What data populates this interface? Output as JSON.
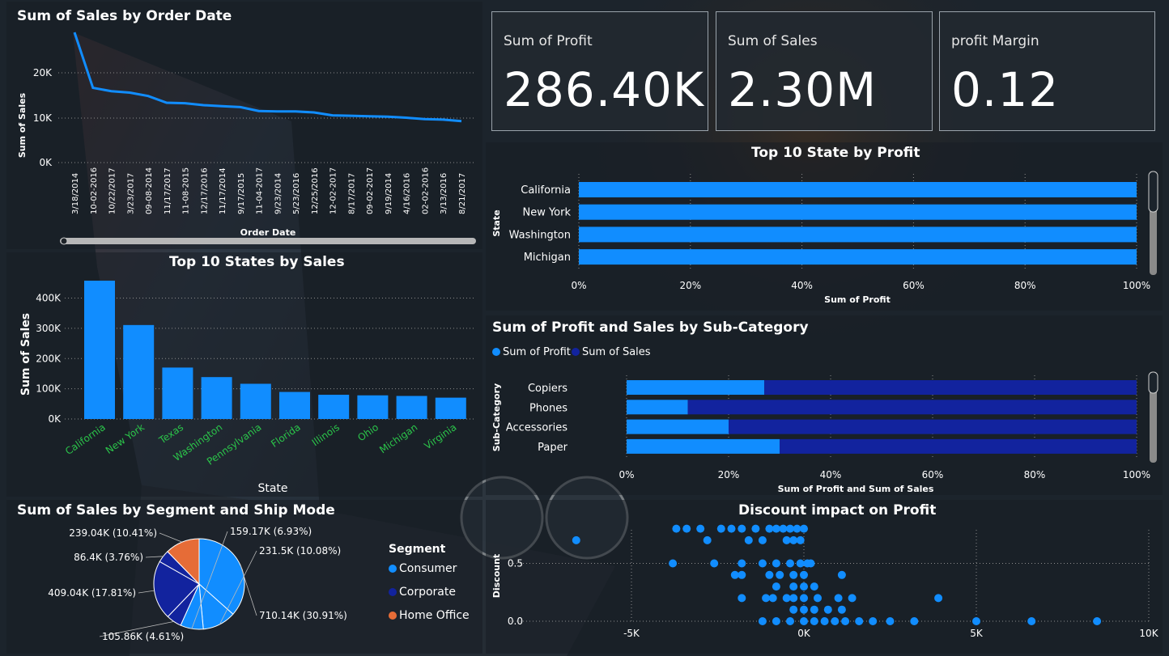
{
  "colors": {
    "primary": "#118dff",
    "secondary": "#12239e",
    "tertiary": "#e66c37",
    "green_label": "#2bc44a"
  },
  "kpis": [
    {
      "label": "Sum of Profit",
      "value": "286.40K"
    },
    {
      "label": "Sum of Sales",
      "value": "2.30M"
    },
    {
      "label": "profit Margin",
      "value": "0.12"
    }
  ],
  "line_chart": {
    "title": "Sum of Sales by Order Date",
    "ylabel": "Sum of Sales",
    "xlabel": "Order Date",
    "yticks": [
      "20K",
      "10K",
      "0K"
    ]
  },
  "states_sales": {
    "title": "Top 10 States by Sales",
    "ylabel": "Sum of Sales",
    "xlabel": "State",
    "yticks": [
      "400K",
      "300K",
      "200K",
      "100K",
      "0K"
    ]
  },
  "states_profit": {
    "title": "Top 10 State by Profit",
    "ylabel": "State",
    "xlabel": "Sum of Profit",
    "xticks": [
      "0%",
      "20%",
      "40%",
      "60%",
      "80%",
      "100%"
    ]
  },
  "subcat": {
    "title": "Sum of Profit and Sales by Sub-Category",
    "ylabel": "Sub-Category",
    "xlabel": "Sum of Profit and Sum of Sales",
    "xticks": [
      "0%",
      "20%",
      "40%",
      "60%",
      "80%",
      "100%"
    ],
    "legend": [
      "Sum of Profit",
      "Sum of Sales"
    ]
  },
  "pie": {
    "title": "Sum of Sales by Segment and Ship Mode",
    "legend_title": "Segment",
    "legend": [
      "Consumer",
      "Corporate",
      "Home Office"
    ]
  },
  "scatter": {
    "title": "Discount impact on Profit",
    "ylabel": "Discount",
    "xticks": [
      "-5K",
      "0K",
      "5K",
      "10K"
    ],
    "yticks": [
      "0.5",
      "0.0"
    ]
  },
  "chart_data": [
    {
      "type": "line",
      "title": "Sum of Sales by Order Date",
      "xlabel": "Order Date",
      "ylabel": "Sum of Sales",
      "ylim": [
        0,
        28000
      ],
      "x": [
        "3/18/2014",
        "10-02-2016",
        "10/22/2017",
        "3/23/2017",
        "09-08-2014",
        "11/17/2017",
        "11-08-2015",
        "12/17/2016",
        "11/17/2014",
        "9/17/2015",
        "11-04-2017",
        "9/23/2014",
        "5/23/2016",
        "12/25/2016",
        "12-02-2017",
        "8/17/2017",
        "09-02-2017",
        "9/19/2014",
        "4/16/2016",
        "02-02-2016",
        "3/13/2016",
        "8/21/2017"
      ],
      "values": [
        27000,
        15500,
        14800,
        14500,
        13800,
        12400,
        12300,
        11900,
        11700,
        11500,
        10700,
        10600,
        10600,
        10400,
        9800,
        9700,
        9600,
        9500,
        9300,
        9000,
        8900,
        8600
      ]
    },
    {
      "type": "bar",
      "title": "Top 10 States by Sales",
      "xlabel": "State",
      "ylabel": "Sum of Sales",
      "ylim": [
        0,
        450000
      ],
      "categories": [
        "California",
        "New York",
        "Texas",
        "Washington",
        "Pennsylvania",
        "Florida",
        "Illinois",
        "Ohio",
        "Michigan",
        "Virginia"
      ],
      "values": [
        457688,
        310876,
        170188,
        138641,
        116512,
        89474,
        80166,
        78258,
        76270,
        70637
      ]
    },
    {
      "type": "bar",
      "title": "Top 10 State by Profit",
      "orientation": "horizontal",
      "xlabel": "Sum of Profit",
      "ylabel": "State",
      "categories": [
        "California",
        "New York",
        "Washington",
        "Michigan"
      ],
      "values": [
        100,
        100,
        100,
        100
      ]
    },
    {
      "type": "bar",
      "title": "Sum of Profit and Sales by Sub-Category",
      "orientation": "horizontal",
      "stacked": "100%",
      "xlabel": "Sum of Profit and Sum of Sales",
      "ylabel": "Sub-Category",
      "categories": [
        "Copiers",
        "Phones",
        "Accessories",
        "Paper"
      ],
      "series": [
        {
          "name": "Sum of Profit",
          "values": [
            27,
            12,
            20,
            30
          ]
        },
        {
          "name": "Sum of Sales",
          "values": [
            73,
            88,
            80,
            70
          ]
        }
      ]
    },
    {
      "type": "pie",
      "title": "Sum of Sales by Segment and Ship Mode",
      "categories": [
        "Consumer",
        "Corporate",
        "Home Office"
      ],
      "labels": [
        "710.14K (30.91%)",
        "105.86K (4.61%)",
        "409.04K (17.81%)",
        "86.4K (3.76%)",
        "239.04K (10.41%)",
        "159.17K (6.93%)",
        "231.5K (10.08%)"
      ],
      "values": [
        710.14,
        231.5,
        159.17,
        105.86,
        409.04,
        86.4,
        239.04
      ],
      "series": [
        "Consumer",
        "Consumer",
        "Consumer",
        "Corporate",
        "Corporate",
        "Corporate",
        "Home Office"
      ]
    },
    {
      "type": "scatter",
      "title": "Discount impact on Profit",
      "ylabel": "Discount",
      "xlim": [
        -10000,
        10000
      ],
      "ylim": [
        0,
        0.85
      ],
      "points": [
        [
          -6600,
          0.7
        ],
        [
          -3700,
          0.8
        ],
        [
          -3400,
          0.8
        ],
        [
          -3000,
          0.8
        ],
        [
          -2800,
          0.7
        ],
        [
          -2400,
          0.8
        ],
        [
          -2100,
          0.8
        ],
        [
          -1800,
          0.8
        ],
        [
          -1600,
          0.7
        ],
        [
          -1400,
          0.8
        ],
        [
          -1200,
          0.7
        ],
        [
          -1000,
          0.8
        ],
        [
          -800,
          0.8
        ],
        [
          -600,
          0.8
        ],
        [
          -400,
          0.8
        ],
        [
          -200,
          0.8
        ],
        [
          0,
          0.8
        ],
        [
          -500,
          0.7
        ],
        [
          -300,
          0.7
        ],
        [
          -100,
          0.7
        ],
        [
          -3800,
          0.5
        ],
        [
          -2600,
          0.5
        ],
        [
          -1800,
          0.5
        ],
        [
          -1200,
          0.5
        ],
        [
          -800,
          0.5
        ],
        [
          -400,
          0.5
        ],
        [
          -100,
          0.5
        ],
        [
          100,
          0.5
        ],
        [
          200,
          0.5
        ],
        [
          -1000,
          0.4
        ],
        [
          -700,
          0.4
        ],
        [
          -300,
          0.4
        ],
        [
          0,
          0.4
        ],
        [
          1100,
          0.4
        ],
        [
          -1800,
          0.4
        ],
        [
          -2000,
          0.4
        ],
        [
          -300,
          0.3
        ],
        [
          0,
          0.3
        ],
        [
          300,
          0.3
        ],
        [
          -800,
          0.3
        ],
        [
          -1800,
          0.2
        ],
        [
          -900,
          0.2
        ],
        [
          -300,
          0.2
        ],
        [
          0,
          0.2
        ],
        [
          400,
          0.2
        ],
        [
          1000,
          0.2
        ],
        [
          1400,
          0.2
        ],
        [
          3900,
          0.2
        ],
        [
          -1100,
          0.2
        ],
        [
          -500,
          0.2
        ],
        [
          0,
          0.1
        ],
        [
          300,
          0.1
        ],
        [
          700,
          0.1
        ],
        [
          1100,
          0.1
        ],
        [
          -300,
          0.1
        ],
        [
          -1200,
          0.0
        ],
        [
          -800,
          0.0
        ],
        [
          -400,
          0.0
        ],
        [
          0,
          0.0
        ],
        [
          300,
          0.0
        ],
        [
          600,
          0.0
        ],
        [
          900,
          0.0
        ],
        [
          1200,
          0.0
        ],
        [
          1600,
          0.0
        ],
        [
          2000,
          0.0
        ],
        [
          2500,
          0.0
        ],
        [
          3200,
          0.0
        ],
        [
          5000,
          0.0
        ],
        [
          6600,
          0.0
        ],
        [
          8500,
          0.0
        ]
      ]
    }
  ]
}
